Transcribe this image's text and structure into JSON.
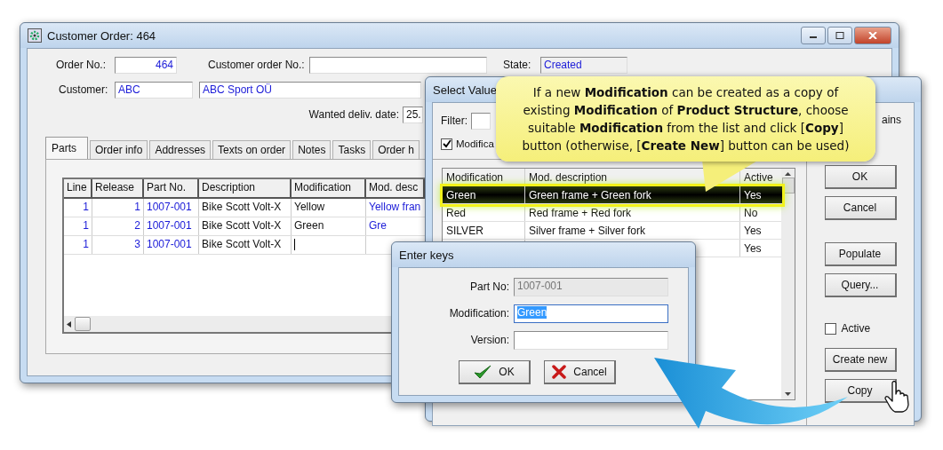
{
  "customer_order_window": {
    "title": "Customer Order: 464",
    "order_no_label": "Order No.:",
    "order_no": "464",
    "customer_order_no_label": "Customer order No.:",
    "state_label": "State:",
    "state": "Created",
    "customer_label": "Customer:",
    "customer_code": "ABC",
    "customer_name": "ABC Sport OÜ",
    "wanted_date_label": "Wanted deliv. date:",
    "wanted_date": "25.",
    "tabs": [
      {
        "label": "Parts",
        "selected": true
      },
      {
        "label": "Order info",
        "selected": false
      },
      {
        "label": "Addresses",
        "selected": false
      },
      {
        "label": "Texts on order",
        "selected": false
      },
      {
        "label": "Notes",
        "selected": false
      },
      {
        "label": "Tasks",
        "selected": false
      },
      {
        "label": "Order h",
        "selected": false
      }
    ],
    "table": {
      "columns": [
        "Line",
        "Release",
        "Part No.",
        "Description",
        "Modification",
        "Mod. desc"
      ],
      "rows": [
        {
          "cells": [
            "1",
            "1",
            "1007-001",
            "Bike Scott Volt-X",
            "Yellow",
            "Yellow fran"
          ],
          "editing": false
        },
        {
          "cells": [
            "1",
            "2",
            "1007-001",
            "Bike Scott Volt-X",
            "Green",
            "Gre"
          ],
          "editing": false
        },
        {
          "cells": [
            "1",
            "3",
            "1007-001",
            "Bike Scott Volt-X"
          ],
          "editing": true
        }
      ]
    }
  },
  "select_value_window": {
    "title": "Select Value",
    "filter_label": "Filter:",
    "filter_check": {
      "label": "Modifica",
      "checked": true
    },
    "contains_label": "ains",
    "list": {
      "columns": [
        "Modification",
        "Mod. description",
        "Active"
      ],
      "rows": [
        {
          "modification": "Green",
          "description": "Green frame + Green fork",
          "active": "Yes",
          "selected": true
        },
        {
          "modification": "Red",
          "description": "Red frame + Red fork",
          "active": "No",
          "selected": false
        },
        {
          "modification": "SILVER",
          "description": "Silver frame + Silver fork",
          "active": "Yes",
          "selected": false
        },
        {
          "active": "Yes",
          "selected": false
        }
      ]
    },
    "control_groups": [
      [
        {
          "kind": "button",
          "label": "OK"
        },
        {
          "kind": "button",
          "label": "Cancel"
        }
      ],
      [
        {
          "kind": "button",
          "label": "Populate"
        },
        {
          "kind": "button",
          "label": "Query..."
        }
      ],
      [
        {
          "kind": "checkbox",
          "label": "Active",
          "checked": false
        },
        {
          "kind": "button",
          "label": "Create new"
        },
        {
          "kind": "button",
          "label": "Copy"
        }
      ]
    ]
  },
  "enter_keys_dialog": {
    "title": "Enter keys",
    "fields": [
      {
        "label": "Part No:",
        "value": "1007-001",
        "disabled": true,
        "highlighted": false
      },
      {
        "label": "Modification:",
        "value": "Green",
        "disabled": false,
        "highlighted": true
      },
      {
        "label": "Version:",
        "disabled": false,
        "highlighted": false
      }
    ],
    "buttons": [
      {
        "kind": "ok",
        "label": "OK"
      },
      {
        "kind": "cancel",
        "label": "Cancel"
      }
    ]
  },
  "callout": {
    "text": "If a new **Modification** can be created as a copy of existing **Modification** of **Product Structure**, choose suitable **Modification** from the list and click [**Copy**] button (otherwise, [**Create New**] button can be used)"
  }
}
